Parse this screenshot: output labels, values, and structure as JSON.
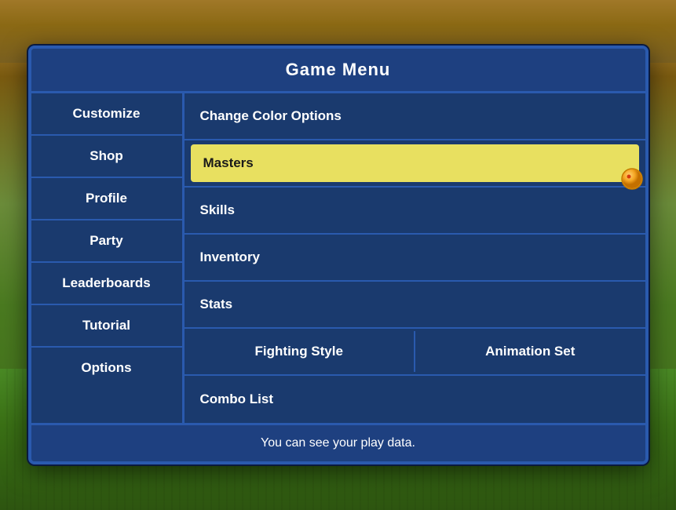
{
  "background": {
    "colors": {
      "top": "#8B6914",
      "bottom": "#4a8a25"
    }
  },
  "menu": {
    "title": "Game Menu",
    "nav": {
      "items": [
        {
          "label": "Customize",
          "id": "customize"
        },
        {
          "label": "Shop",
          "id": "shop"
        },
        {
          "label": "Profile",
          "id": "profile"
        },
        {
          "label": "Party",
          "id": "party"
        },
        {
          "label": "Leaderboards",
          "id": "leaderboards"
        },
        {
          "label": "Tutorial",
          "id": "tutorial"
        },
        {
          "label": "Options",
          "id": "options"
        }
      ]
    },
    "content": {
      "rows": [
        {
          "type": "single",
          "label": "Change Color Options",
          "highlighted": false
        },
        {
          "type": "single",
          "label": "Masters",
          "highlighted": true
        },
        {
          "type": "single",
          "label": "Skills",
          "highlighted": false
        },
        {
          "type": "single",
          "label": "Inventory",
          "highlighted": false
        },
        {
          "type": "single",
          "label": "Stats",
          "highlighted": false
        },
        {
          "type": "double",
          "left": "Fighting Style",
          "right": "Animation Set"
        },
        {
          "type": "single",
          "label": "Combo List",
          "highlighted": false
        }
      ]
    },
    "footer": "You can see your play data."
  }
}
